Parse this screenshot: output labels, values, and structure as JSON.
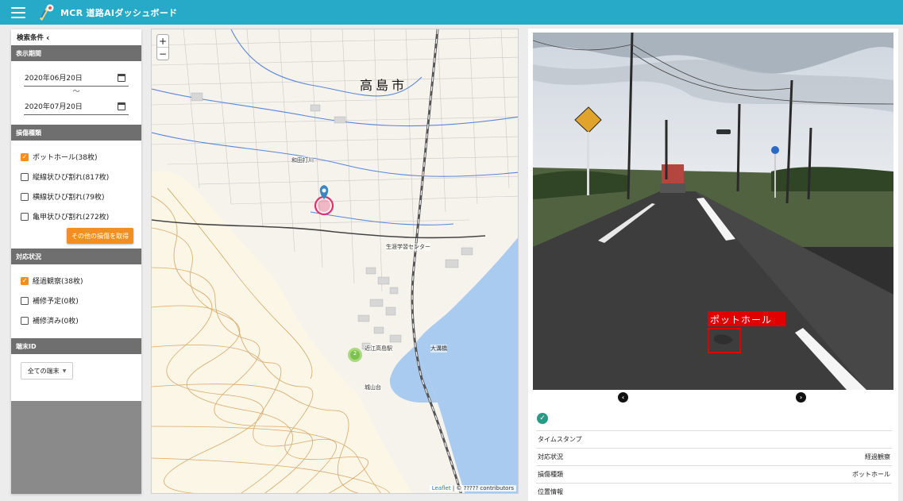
{
  "app": {
    "title": "MCR 道路AIダッシュボード"
  },
  "sidebar": {
    "header": "検索条件",
    "collapse_glyph": "‹",
    "period": {
      "title": "表示期間",
      "start": "2020年06月20日",
      "separator": "〜",
      "end": "2020年07月20日"
    },
    "damage": {
      "title": "損傷種類",
      "items": [
        {
          "label": "ポットホール(38枚)",
          "checked": true
        },
        {
          "label": "縦線状ひび割れ(817枚)",
          "checked": false
        },
        {
          "label": "横線状ひび割れ(79枚)",
          "checked": false
        },
        {
          "label": "亀甲状ひび割れ(272枚)",
          "checked": false
        }
      ],
      "button": "その他の損傷を取得"
    },
    "status": {
      "title": "対応状況",
      "items": [
        {
          "label": "経過観察(38枚)",
          "checked": true
        },
        {
          "label": "補修予定(0枚)",
          "checked": false
        },
        {
          "label": "補修済み(0枚)",
          "checked": false
        }
      ]
    },
    "device": {
      "title": "端末ID",
      "select_value": "全ての端末"
    }
  },
  "map": {
    "zoom_in": "+",
    "zoom_out": "−",
    "place_label": "高島市",
    "labels": {
      "station": "近江高島駅",
      "bridge": "大溝橋",
      "center": "生涯学習センター",
      "castle": "城山台",
      "river": "和田打川"
    },
    "cluster_count": "2",
    "attribution": {
      "link": "Leaflet",
      "text": "| © ????? contributors"
    }
  },
  "viewer": {
    "detection_label": "ポットホール",
    "prev_icon": "‹",
    "next_icon": "›",
    "info": [
      {
        "label": "タイムスタンプ",
        "value": ""
      },
      {
        "label": "対応状況",
        "value": "経過観察"
      },
      {
        "label": "損傷種類",
        "value": "ポットホール"
      },
      {
        "label": "位置情報",
        "value": ""
      }
    ]
  },
  "colors": {
    "appbar": "#26aac8",
    "accent": "#f28f22",
    "section": "#6f6f6f",
    "check": "#2a9a86",
    "detection": "#e00000"
  }
}
